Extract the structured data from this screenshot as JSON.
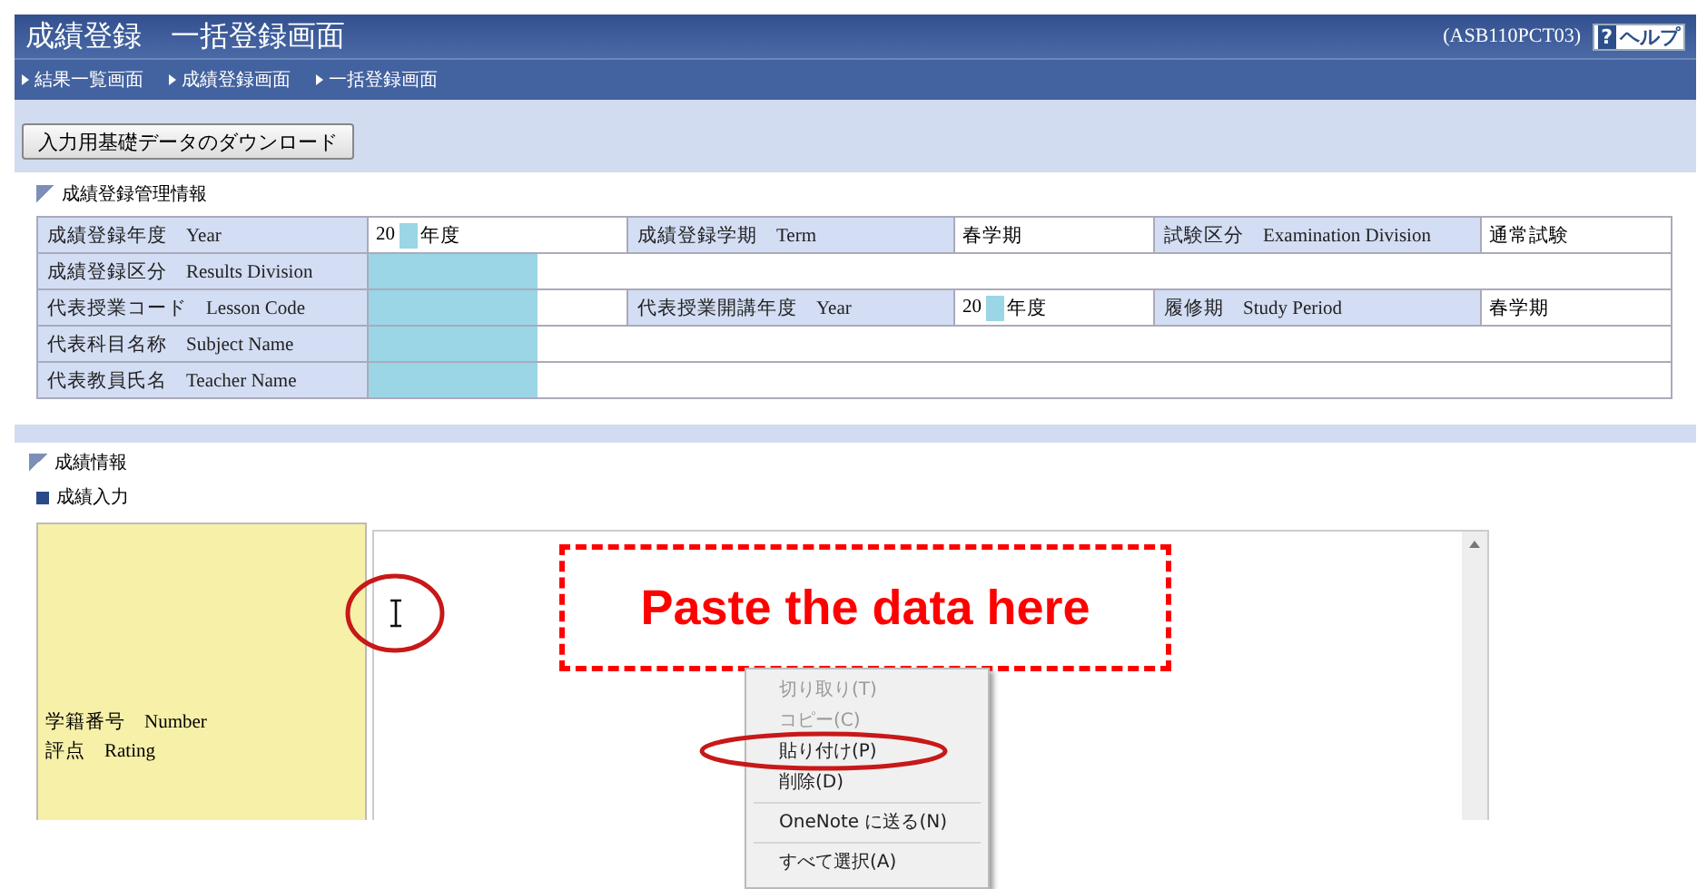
{
  "header": {
    "title": "成績登録　一括登録画面",
    "screen_id": "(ASB110PCT03)",
    "help": {
      "icon_text": "?",
      "label": "ヘルプ"
    }
  },
  "breadcrumbs": [
    "結果一覧画面",
    "成績登録画面",
    "一括登録画面"
  ],
  "download_button": "入力用基礎データのダウンロード",
  "management_panel": {
    "title": "成績登録管理情報",
    "rows": [
      [
        {
          "kind": "label",
          "text": "成績登録年度",
          "en": "Year"
        },
        {
          "kind": "value",
          "before": "20",
          "masked": true,
          "after": "年度"
        },
        {
          "kind": "label",
          "text": "成績登録学期",
          "en": "Term"
        },
        {
          "kind": "value",
          "after": "春学期"
        },
        {
          "kind": "label",
          "text": "試験区分",
          "en": "Examination Division"
        },
        {
          "kind": "value",
          "after": "通常試験"
        }
      ],
      [
        {
          "kind": "label",
          "text": "成績登録区分",
          "en": "Results Division"
        },
        {
          "kind": "value",
          "masked": true
        }
      ],
      [
        {
          "kind": "label",
          "text": "代表授業コード",
          "en": "Lesson Code"
        },
        {
          "kind": "value",
          "masked": true
        },
        {
          "kind": "label",
          "text": "代表授業開講年度",
          "en": "Year"
        },
        {
          "kind": "value",
          "before": "20",
          "masked": true,
          "after": "年度"
        },
        {
          "kind": "label",
          "text": "履修期",
          "en": "Study Period"
        },
        {
          "kind": "value",
          "after": "春学期"
        }
      ],
      [
        {
          "kind": "label",
          "text": "代表科目名称",
          "en": "Subject Name"
        },
        {
          "kind": "value",
          "masked": true
        }
      ],
      [
        {
          "kind": "label",
          "text": "代表教員氏名",
          "en": "Teacher Name"
        },
        {
          "kind": "value",
          "masked": true
        }
      ]
    ]
  },
  "grades_panel": {
    "title": "成績情報",
    "subtitle": "成績入力",
    "input_label": [
      {
        "text": "学籍番号",
        "en": "Number"
      },
      {
        "text": "評点",
        "en": "Rating"
      }
    ]
  },
  "annotation": {
    "text": "Paste the data here"
  },
  "context_menu": {
    "groups": [
      [
        {
          "label": "切り取り(T)",
          "disabled": true
        },
        {
          "label": "コピー(C)",
          "disabled": true
        },
        {
          "label": "貼り付け(P)",
          "disabled": false
        },
        {
          "label": "削除(D)",
          "disabled": false
        }
      ],
      [
        {
          "label": "OneNote に送る(N)",
          "disabled": false
        }
      ],
      [
        {
          "label": "すべて選択(A)",
          "disabled": false
        }
      ]
    ]
  }
}
